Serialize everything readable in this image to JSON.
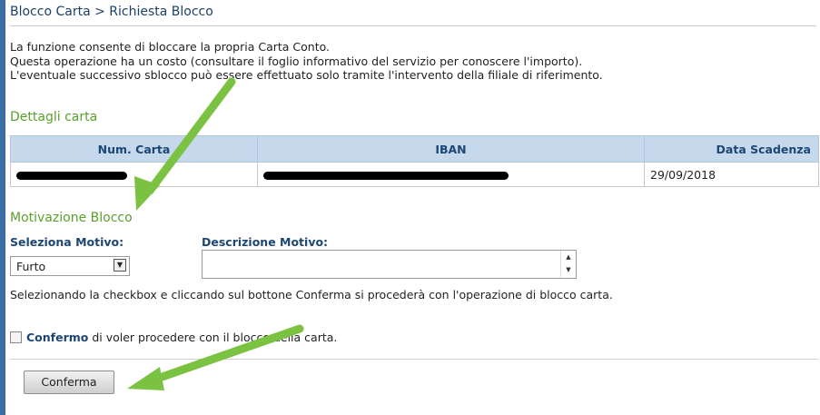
{
  "breadcrumb": "Blocco Carta > Richiesta Blocco",
  "intro": {
    "line1": "La funzione consente di bloccare la propria Carta Conto.",
    "line2": "Questa operazione ha un costo (consultare il foglio informativo del servizio per conoscere l'importo).",
    "line3": "L'eventuale successivo sblocco può essere effettuato solo tramite l'intervento della filiale di riferimento."
  },
  "card_details": {
    "title": "Dettagli carta",
    "columns": [
      "Num. Carta",
      "IBAN",
      "Data Scadenza"
    ],
    "row": {
      "card_number": "[redacted]",
      "iban": "[redacted]",
      "expiry": "29/09/2018"
    }
  },
  "block_reason": {
    "title": "Motivazione Blocco",
    "select_label": "Seleziona Motivo:",
    "select_value": "Furto",
    "description_label": "Descrizione Motivo:",
    "description_value": ""
  },
  "note": "Selezionando la checkbox e cliccando sul bottone Conferma si procederà con l'operazione di blocco carta.",
  "confirm": {
    "strong": "Confermo",
    "text": " di voler procedere con il blocco della carta."
  },
  "submit_label": "Conferma",
  "colors": {
    "accent_arrow": "#7cc242",
    "section_title": "#5aa02c",
    "header_bg": "#c5d8ec"
  }
}
